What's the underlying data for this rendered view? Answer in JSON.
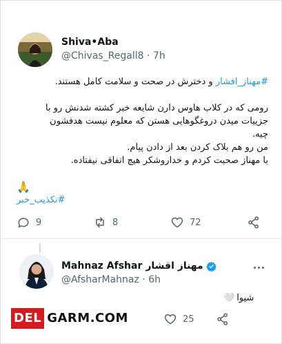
{
  "tweet": {
    "display_name": "Shiva•Aba",
    "handle": "@Chivas_Regall8",
    "time": "7h",
    "hashtag": "#مهناز_افشار",
    "first_line_rest": " و دخترش در صحت و سلامت کامل هستند.",
    "paragraph_lines": [
      "رومی که در کلاب هاوس دارن شایعه خبر کشته شدنش رو با",
      "جزییات میدن دروغگوهایی هستن که معلوم نیست هدفشون",
      "چیه.",
      "من رو هم بلاک کردن بعد از دادن پیام.",
      "با مهناز صحبت کردم و خداروشکر هیچ اتفاقی نیفتاده."
    ],
    "emoji": "🙏",
    "closing_hashtag": "#تکذیب_خبر",
    "replies": "9",
    "retweets": "8",
    "likes": "72"
  },
  "reply": {
    "display_name_en": "Mahnaz Afshar",
    "display_name_fa": "مهناز افشار",
    "handle": "@AfsharMahnaz",
    "time": "6h",
    "text": "شیوا",
    "emoji": "🤍",
    "likes": "25"
  },
  "watermark": {
    "part1": "DEL",
    "part2": "GARM.COM"
  },
  "colors": {
    "link": "#1d9bf0",
    "verified": "#1d9bf0",
    "muted": "#536471",
    "watermark_red": "#d71920"
  }
}
